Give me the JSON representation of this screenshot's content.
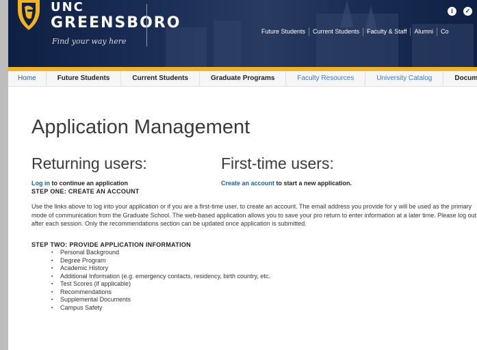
{
  "header": {
    "logo_unc": "UNC",
    "logo_name": "GREENSBORO",
    "logo_tagline": "Find your way here",
    "top_links": [
      "Future Students",
      "Current Students",
      "Faculty & Staff",
      "Alumni",
      "Co"
    ],
    "icons": [
      "info-icon",
      "check-icon"
    ]
  },
  "nav": {
    "items": [
      "Home",
      "Future Students",
      "Current Students",
      "Graduate Programs",
      "Faculty Resources",
      "University Catalog",
      "Docume"
    ]
  },
  "page": {
    "title": "Application Management",
    "returning_heading": "Returning users:",
    "firsttime_heading": "First-time users:",
    "login_link": "Log in",
    "login_rest": " to continue an application",
    "step_one": "STEP ONE: CREATE AN ACCOUNT",
    "create_link": "Create an account",
    "create_rest": " to start a new application.",
    "paragraph": "Use the links above to log into your application or if you are a first-time user, to create an account. The email address you provide for y will be used as the primary mode of communication from the Graduate School. The web-based application allows you to save your pro return to enter information at a later time. Please log out after each session. Only the recommendations section can be updated once application is submitted.",
    "step_two": "STEP TWO: PROVIDE APPLICATION INFORMATION",
    "list": [
      "Personal Background",
      "Degree Program",
      "Academic History",
      "Additional Information (e.g. emergency contacts, residency, birth country, etc.",
      "Test Scores (if applicable)",
      "Recommendations",
      "Supplemental Documents",
      "Campus Safety"
    ]
  },
  "colors": {
    "navy": "#0f2044",
    "gold": "#f3b21f",
    "link": "#1f5fa5"
  }
}
